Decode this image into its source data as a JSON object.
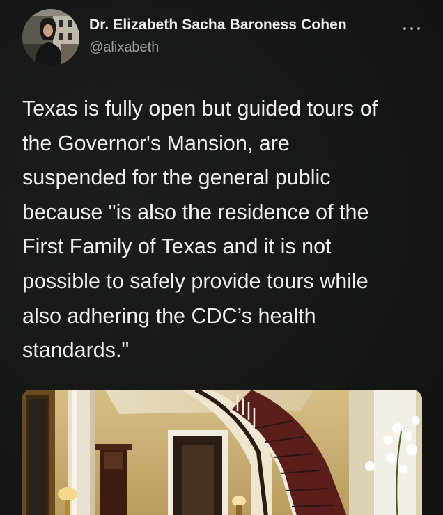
{
  "author": {
    "display_name": "Dr. Elizabeth Sacha Baroness Cohen",
    "handle": "@alixabeth",
    "avatar_icon": "profile-photo"
  },
  "tweet": {
    "text_lines": [
      "Texas is fully open but guided tours of",
      "the Governor's Mansion, are",
      "suspended for the general public",
      "because \"is also the residence of the",
      "First Family of Texas and it is not",
      "possible to safely provide tours while",
      "also adhering the CDC’s health",
      "standards.\""
    ]
  },
  "media": {
    "icon": "mansion-interior-photo"
  },
  "icons": {
    "more_options": "more-options-icon"
  },
  "colors": {
    "background": "#151815",
    "text_primary": "#eef0ec",
    "text_secondary": "#9aa09a"
  }
}
